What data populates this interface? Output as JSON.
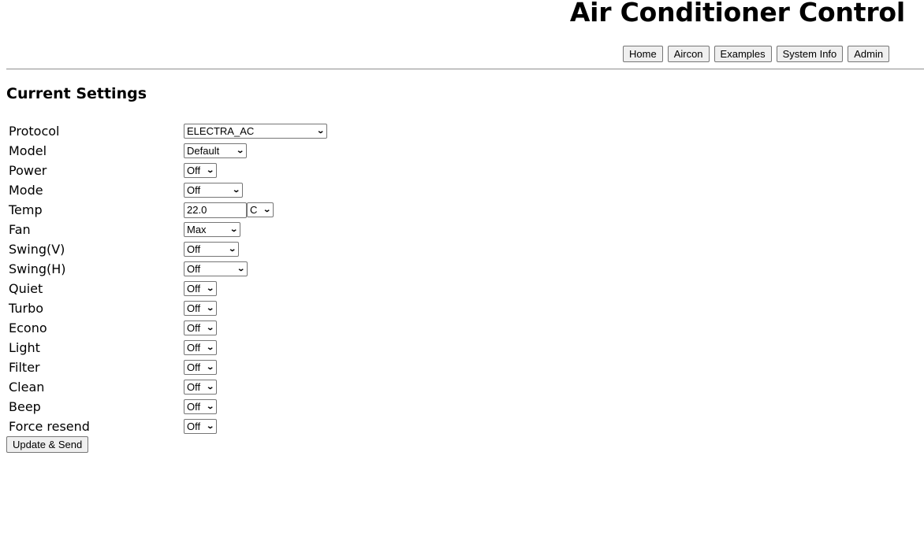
{
  "header": {
    "title": "Air Conditioner Control",
    "nav": [
      {
        "label": "Home"
      },
      {
        "label": "Aircon"
      },
      {
        "label": "Examples"
      },
      {
        "label": "System Info"
      },
      {
        "label": "Admin"
      }
    ]
  },
  "section": {
    "title": "Current Settings"
  },
  "settings": {
    "protocol": {
      "label": "Protocol",
      "value": "ELECTRA_AC"
    },
    "model": {
      "label": "Model",
      "value": "Default"
    },
    "power": {
      "label": "Power",
      "value": "Off"
    },
    "mode": {
      "label": "Mode",
      "value": "Off"
    },
    "temp": {
      "label": "Temp",
      "value": "22.0",
      "unit": "C"
    },
    "fan": {
      "label": "Fan",
      "value": "Max"
    },
    "swingv": {
      "label": "Swing(V)",
      "value": "Off"
    },
    "swingh": {
      "label": "Swing(H)",
      "value": "Off"
    },
    "quiet": {
      "label": "Quiet",
      "value": "Off"
    },
    "turbo": {
      "label": "Turbo",
      "value": "Off"
    },
    "econo": {
      "label": "Econo",
      "value": "Off"
    },
    "light": {
      "label": "Light",
      "value": "Off"
    },
    "filter": {
      "label": "Filter",
      "value": "Off"
    },
    "clean": {
      "label": "Clean",
      "value": "Off"
    },
    "beep": {
      "label": "Beep",
      "value": "Off"
    },
    "force_resend": {
      "label": "Force resend",
      "value": "Off"
    }
  },
  "actions": {
    "submit_label": "Update & Send"
  },
  "icons": {
    "dropdown": "chevron-down-icon",
    "chevron_glyph": "⌄"
  }
}
